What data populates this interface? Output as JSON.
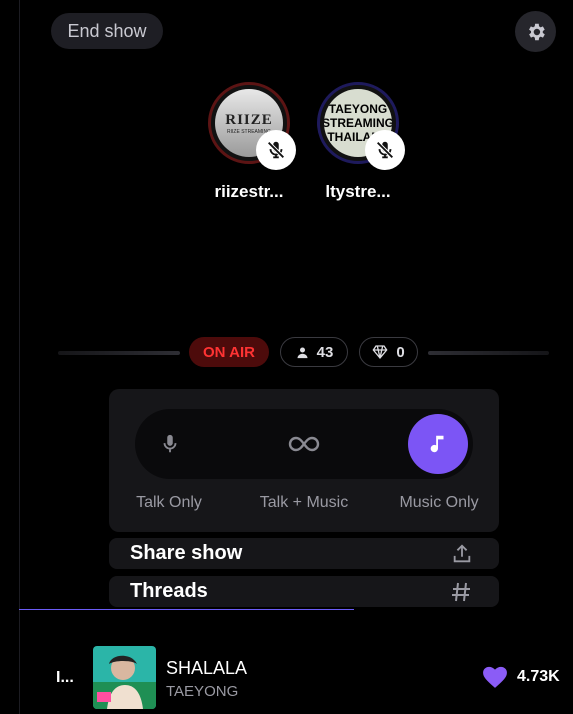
{
  "header": {
    "end_show_label": "End show",
    "settings_icon": "gear-icon"
  },
  "hosts": [
    {
      "name": "riizestr...",
      "avatar_text": "RIIZE",
      "avatar_subtext": "RIIZE STREAMING",
      "ring_color": "#5c1414",
      "muted": true
    },
    {
      "name": "ltystre...",
      "avatar_lines": [
        "TAEYONG",
        "STREAMING",
        "THAILAND"
      ],
      "ring_color": "#1e1a5c",
      "muted": true
    }
  ],
  "status": {
    "on_air_label": "ON AIR",
    "listener_count": "43",
    "gem_count": "0"
  },
  "modes": {
    "talk_label": "Talk Only",
    "mix_label": "Talk + Music",
    "music_label": "Music Only",
    "selected": "Music Only",
    "accent_color": "#7c55f5"
  },
  "actions": {
    "share_label": "Share show",
    "threads_label": "Threads"
  },
  "now_playing": {
    "index_label": "I...",
    "title": "SHALALA",
    "artist": "TAEYONG",
    "like_count": "4.73K",
    "like_color": "#8b5cf6"
  }
}
